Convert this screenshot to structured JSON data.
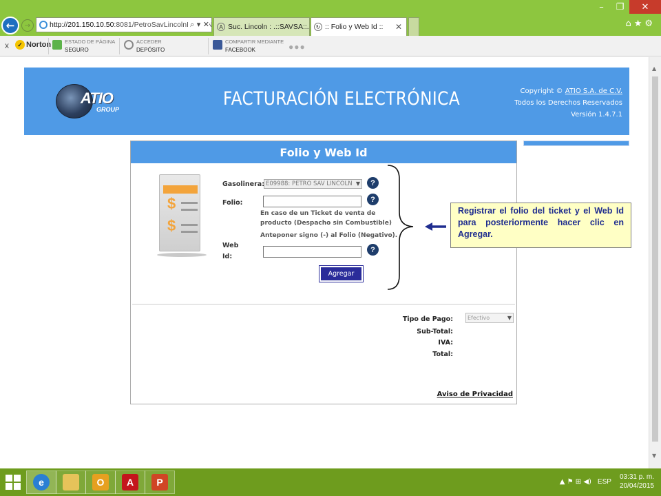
{
  "browser": {
    "url": "http://201.150.10.50:8081/PetroSavLincolnFE/FENotaD",
    "url_host": "http://201.150.10.50",
    "url_path": ":8081/PetroSavLincolnFE/FENotaD",
    "address_tools": "⌕ ▾ ✕",
    "tabs": [
      {
        "label": "Suc. Lincoln : .::SAVSA::."
      },
      {
        "label": ":: Folio y Web Id ::"
      }
    ],
    "window_controls": {
      "minimize": "–",
      "restore": "❐",
      "close": "✕"
    },
    "right_icons": "⌂★⚙"
  },
  "toolbar": {
    "close": "x",
    "norton": "Norton",
    "items": [
      {
        "line1": "ESTADO DE PÁGINA",
        "line2": "SEGURO"
      },
      {
        "line1": "ACCEDER",
        "line2": "DEPÓSITO"
      },
      {
        "line1": "COMPARTIR MEDIANTE",
        "line2": "FACEBOOK"
      }
    ],
    "more": "●●●"
  },
  "header": {
    "logo_text": "ATIO",
    "logo_sub": "GROUP",
    "title": "FACTURACIÓN ELECTRÓNICA",
    "copyright_prefix": "Copyright ©",
    "copyright_link": "ATIO S.A. de C.V.",
    "rights": "Todos los Derechos Reservados",
    "version": "Versión 1.4.7.1"
  },
  "form": {
    "title": "Folio y Web Id",
    "gasolinera_label": "Gasolinera:",
    "gasolinera_value": "E09988: PETRO SAV LINCOLN",
    "folio_label": "Folio:",
    "folio_value": "",
    "hint_lines": [
      "En caso de un Ticket de venta de",
      "producto (Despacho sin Combustible)",
      "Anteponer signo (-) al Folio (Negativo)."
    ],
    "webid_label_1": "Web",
    "webid_label_2": "Id:",
    "webid_value": "",
    "help_glyph": "?",
    "add_button": "Agregar",
    "tipo_pago_label": "Tipo de Pago:",
    "tipo_pago_value": "Efectivo",
    "subtotal_label": "Sub-Total:",
    "iva_label": "IVA:",
    "total_label": "Total:",
    "privacy_link": "Aviso de Privacidad"
  },
  "annotation": {
    "text": "Registrar el folio del ticket y el Web Id para posteriormente hacer clic en Agregar."
  },
  "taskbar": {
    "apps": [
      "ie-icon",
      "file-explorer-icon",
      "outlook-icon",
      "acrobat-icon",
      "powerpoint-icon"
    ],
    "tray_symbols": "▲  ⚑  ⊞  ◀)",
    "language": "ESP",
    "time": "03:31 p. m.",
    "date": "20/04/2015"
  },
  "colors": {
    "browser_frame": "#8dc63f",
    "banner_blue": "#4f9ae6",
    "button_navy": "#2a2c9a",
    "help_icon": "#1e3d6b",
    "callout_bg": "#ffffc5",
    "callout_text": "#1f2d8f",
    "taskbar": "#6e9c1e"
  }
}
